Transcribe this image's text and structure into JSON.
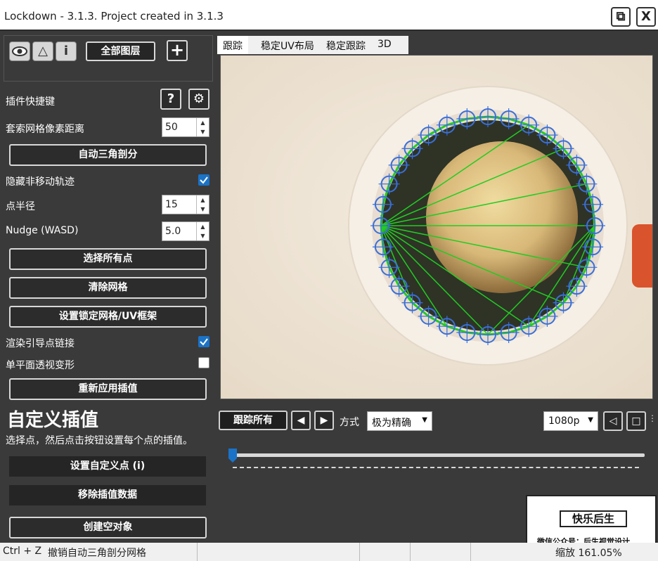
{
  "window": {
    "title": "Lockdown - 3.1.3. Project created in 3.1.3",
    "restore_label": "⧉",
    "close_label": "X"
  },
  "toolbox": {
    "eye_label": "👁",
    "triangle_label": "△",
    "info_label": "i",
    "all_layers_label": "全部图层",
    "add_label": "+"
  },
  "panel": {
    "plugin_shortcuts_label": "插件快捷键",
    "help_label": "?",
    "settings_label": "⚙",
    "lasso_grid_label": "套索网格像素距离",
    "lasso_grid_value": "50",
    "auto_triangulate_label": "自动三角剖分",
    "hide_static_tracks_label": "隐藏非移动轨迹",
    "hide_static_tracks_checked": true,
    "point_radius_label": "点半径",
    "point_radius_value": "15",
    "nudge_label": "Nudge (WASD)",
    "nudge_value": "5.0",
    "select_all_label": "选择所有点",
    "clear_grid_label": "清除网格",
    "set_lock_grid_label": "设置锁定网格/UV框架",
    "render_guides_label": "渲染引导点链接",
    "render_guides_checked": true,
    "single_plane_label": "单平面透视变形",
    "single_plane_checked": false,
    "reapply_interp_label": "重新应用插值",
    "custom_interp_heading": "自定义插值",
    "custom_interp_desc": "选择点，然后点击按钮设置每个点的插值。",
    "set_custom_point_label": "设置自定义点 (i)",
    "remove_interp_label": "移除插值数据",
    "create_null_label": "创建空对象"
  },
  "tabs": [
    {
      "label": "跟踪",
      "active": true
    },
    {
      "label": "稳定UV布局",
      "active": false
    },
    {
      "label": "稳定跟踪",
      "active": false
    },
    {
      "label": "3D",
      "active": false
    }
  ],
  "controls": {
    "track_all_label": "跟踪所有",
    "prev_label": "◀",
    "next_label": "▶",
    "mode_label": "方式",
    "mode_value": "极为精确",
    "resolution_value": "1080p",
    "timeline_position": 0.0
  },
  "statusbar": {
    "shortcut": "Ctrl + Z",
    "message": "撤销自动三角剖分网格",
    "zoom": "缩放 161.05%"
  },
  "watermark": {
    "title": "快乐后生",
    "subtitle": "微信公众号：后生视觉设计"
  },
  "colors": {
    "track_point": "#3a6fd8",
    "mesh_line": "#22cc22",
    "accent": "#1a73c7"
  }
}
